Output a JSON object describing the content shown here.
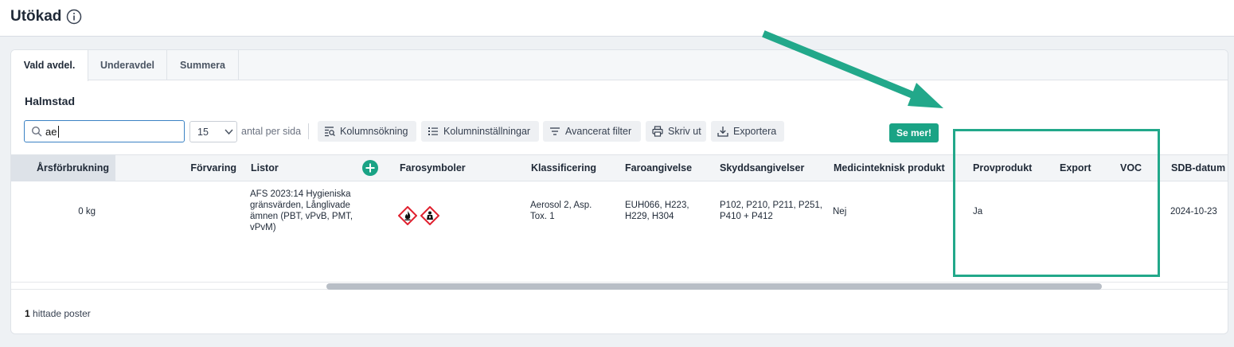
{
  "header": {
    "title": "Utökad"
  },
  "tabs": [
    {
      "label": "Vald avdel."
    },
    {
      "label": "Underavdel"
    },
    {
      "label": "Summera"
    }
  ],
  "department": "Halmstad",
  "search": {
    "value": "ae",
    "placeholder": ""
  },
  "per_page": {
    "value": "15",
    "label": "antal per sida"
  },
  "toolbar": {
    "column_search": "Kolumnsökning",
    "column_settings": "Kolumninställningar",
    "advanced_filter": "Avancerat filter",
    "print": "Skriv ut",
    "export": "Exportera"
  },
  "see_more": "Se mer!",
  "table": {
    "columns": [
      "Årsförbrukning",
      "Förvaring",
      "Listor",
      "Farosymboler",
      "Klassificering",
      "Faroangivelse",
      "Skyddsangivelser",
      "Medicinteknisk produkt",
      "Provprodukt",
      "Export",
      "VOC",
      "SDB-datum"
    ],
    "row": {
      "arsforbrukning": "0 kg",
      "forvaring": "",
      "listor": [
        "AFS 2023:14 Hygieniska",
        "gränsvärden, Långlivade",
        "ämnen (PBT, vPvB, PMT,",
        "vPvM)"
      ],
      "farosymboler": [
        "flame-hazard-icon",
        "health-hazard-icon"
      ],
      "klassificering": [
        "Aerosol 2, Asp.",
        "Tox. 1"
      ],
      "faroangivelse": [
        "EUH066, H223,",
        "H229, H304"
      ],
      "skyddsangivelser": [
        "P102, P210, P211, P251,",
        "P410 + P412"
      ],
      "medicinteknisk": "Nej",
      "provprodukt": "Ja",
      "export": "",
      "voc": "",
      "sdb_datum": "2024-10-23"
    }
  },
  "footer": {
    "count": "1",
    "label": " hittade poster"
  },
  "colors": {
    "accent": "#1aa385",
    "hazard_red": "#e0202e",
    "annotation": "#22a88a"
  }
}
